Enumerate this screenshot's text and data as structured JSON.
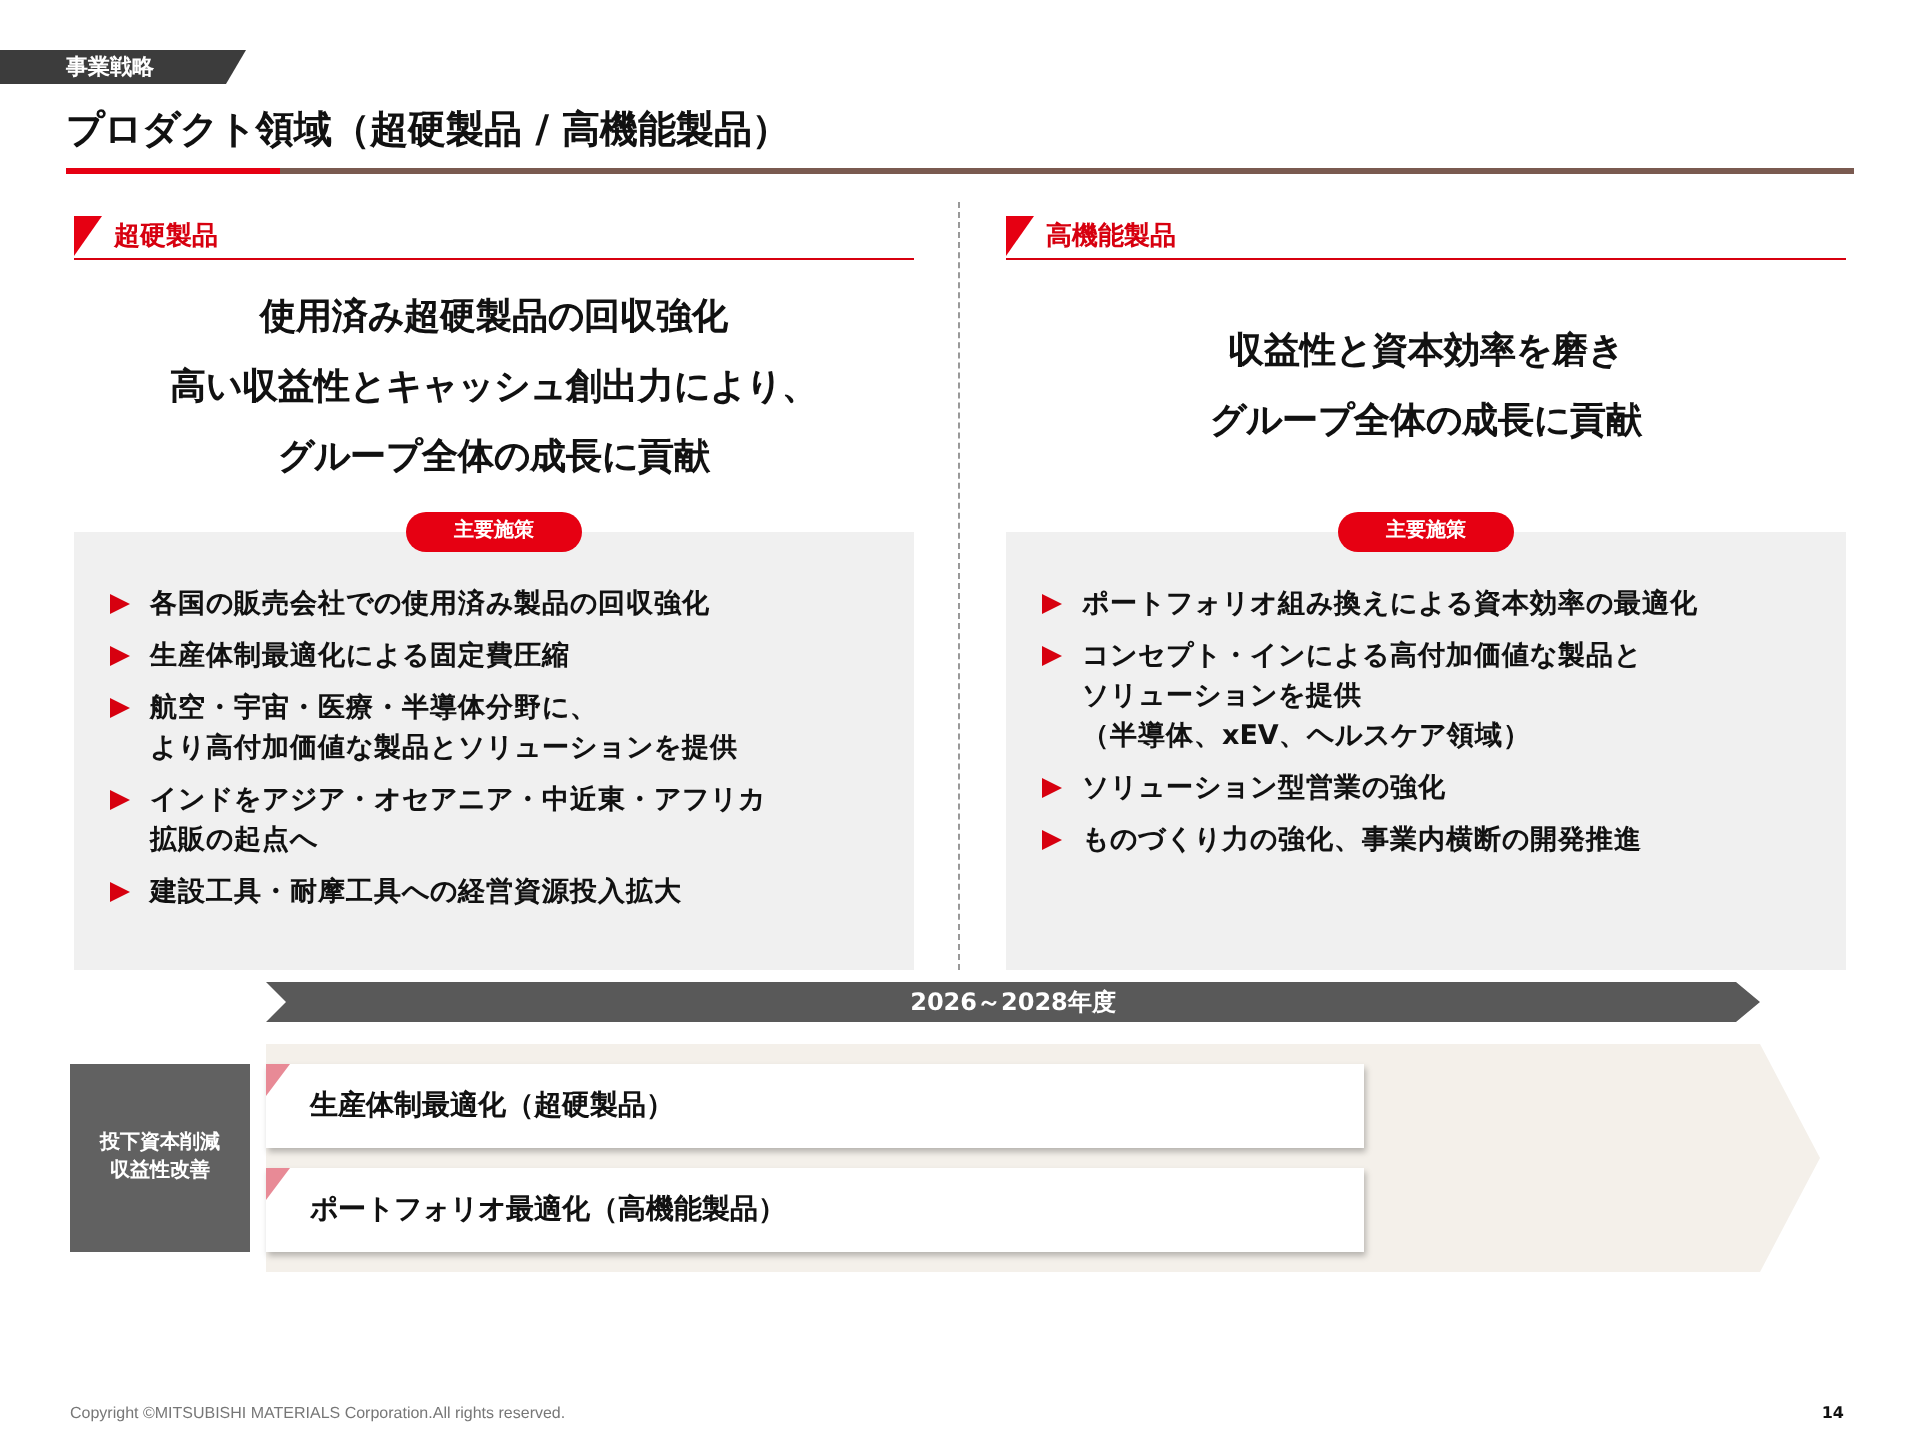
{
  "header_tag": "事業戦略",
  "title": "プロダクト領域（超硬製品 / 高機能製品）",
  "segments": [
    {
      "label": "超硬製品",
      "headline": [
        "使用済み超硬製品の回収強化",
        "高い収益性とキャッシュ創出力により、",
        "グループ全体の成長に貢献"
      ],
      "badge": "主要施策",
      "measures": [
        [
          "各国の販売会社での使用済み製品の回収強化"
        ],
        [
          "生産体制最適化による固定費圧縮"
        ],
        [
          "航空・宇宙・医療・半導体分野に、",
          "より高付加価値な製品とソリューションを提供"
        ],
        [
          "インドをアジア・オセアニア・中近東・アフリカ",
          "拡販の起点へ"
        ],
        [
          "建設工具・耐摩工具への経営資源投入拡大"
        ]
      ]
    },
    {
      "label": "高機能製品",
      "headline": [
        "収益性と資本効率を磨き",
        "グループ全体の成長に貢献"
      ],
      "badge": "主要施策",
      "measures": [
        [
          "ポートフォリオ組み換えによる資本効率の最適化"
        ],
        [
          "コンセプト・インによる高付加価値な製品と",
          "ソリューションを提供",
          "（半導体、xEV、ヘルスケア領域）"
        ],
        [
          "ソリューション型営業の強化"
        ],
        [
          "ものづくり力の強化、事業内横断の開発推進"
        ]
      ]
    }
  ],
  "timeline": {
    "period": "2026～2028年度",
    "category": [
      "投下資本削減",
      "収益性改善"
    ],
    "initiatives": [
      "生産体制最適化（超硬製品）",
      "ポートフォリオ最適化（高機能製品）"
    ]
  },
  "footer": {
    "copyright": "Copyright ©MITSUBISHI MATERIALS Corporation.All rights reserved.",
    "page": "14"
  }
}
